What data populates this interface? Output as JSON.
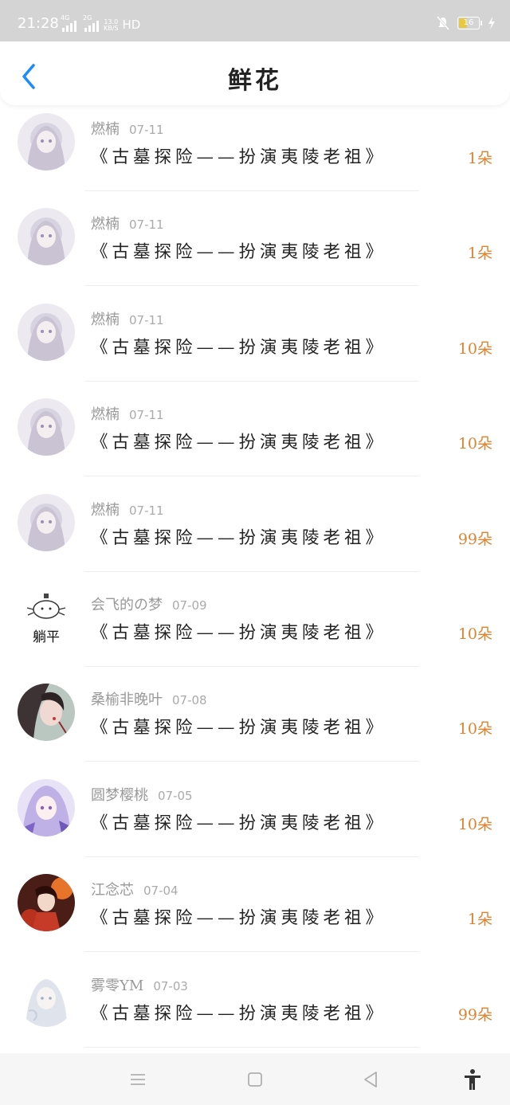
{
  "status_bar": {
    "time": "21:28",
    "signal_1": "4G",
    "signal_2": "2G",
    "speed_value": "13.0",
    "speed_unit": "KB/S",
    "hd": "HD",
    "battery": "16"
  },
  "header": {
    "title": "鲜花",
    "back_icon": "chevron-left-icon"
  },
  "records": [
    {
      "user": "燃楠",
      "date": "07-11",
      "work": "《古墓探险——扮演夷陵老祖》",
      "amount": "1朵"
    },
    {
      "user": "燃楠",
      "date": "07-11",
      "work": "《古墓探险——扮演夷陵老祖》",
      "amount": "1朵"
    },
    {
      "user": "燃楠",
      "date": "07-11",
      "work": "《古墓探险——扮演夷陵老祖》",
      "amount": "10朵"
    },
    {
      "user": "燃楠",
      "date": "07-11",
      "work": "《古墓探险——扮演夷陵老祖》",
      "amount": "10朵"
    },
    {
      "user": "燃楠",
      "date": "07-11",
      "work": "《古墓探险——扮演夷陵老祖》",
      "amount": "99朵"
    },
    {
      "user": "会飞的の梦",
      "date": "07-09",
      "work": "《古墓探险——扮演夷陵老祖》",
      "amount": "10朵",
      "avatar_text": "躺平"
    },
    {
      "user": "桑榆非晚叶",
      "date": "07-08",
      "work": "《古墓探险——扮演夷陵老祖》",
      "amount": "10朵"
    },
    {
      "user": "圆梦樱桃",
      "date": "07-05",
      "work": "《古墓探险——扮演夷陵老祖》",
      "amount": "10朵"
    },
    {
      "user": "江念芯",
      "date": "07-04",
      "work": "《古墓探险——扮演夷陵老祖》",
      "amount": "1朵"
    },
    {
      "user": "雾零YM",
      "date": "07-03",
      "work": "《古墓探险——扮演夷陵老祖》",
      "amount": "99朵"
    }
  ],
  "colors": {
    "accent": "#1a8cff",
    "amount": "#e0832f",
    "status_bar": "#d4d4d4"
  },
  "nav": {
    "menu_icon": "menu-icon",
    "home_icon": "square-home-icon",
    "back_icon": "triangle-back-icon",
    "accessibility_icon": "accessibility-icon"
  }
}
